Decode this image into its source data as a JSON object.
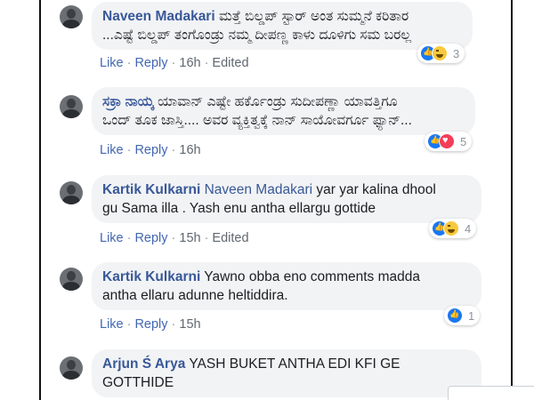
{
  "comments": [
    {
      "author": "Naveen Madakari",
      "mention": "",
      "text_lines": [
        "ಮತ್ತೆ ಬಿಲ್ಡಪ್ ಸ್ಟಾರ್ ಅಂತ ಸುಮ್ಮನೆ ಕರಿತಾರ",
        "...ಎಷ್ಟೆ ಬಿಲ್ಡಪ್ ತಂಗೊಂಡ್ರು ನಮ್ಮ ದೀಪಣ್ಣ ಕಾಳು ದೂಳಿಗು ಸಮ ಬರಲ್ಲ"
      ],
      "like": "Like",
      "reply": "Reply",
      "time": "16h",
      "edited": "Edited",
      "reactions": [
        "like",
        "haha"
      ],
      "reaction_count": "3"
    },
    {
      "author": "ಸಕ್ರಾ ನಾಯ್ಕ",
      "mention": "",
      "text_lines": [
        "ಯಾವಾನ್ ಎಷ್ಟೇ ಹರ್ಕೊಂಡ್ರು ಸುದೀಪಣ್ಣಾ ಯಾವತ್ತಿಗೂ",
        "ಒಂದ್ ತೂಕ ಜಾಸ್ತಿ.... ಅವರ ವ್ಯಕ್ತಿತ್ವಕ್ಕೆ ನಾನ್ ಸಾಯೋವರ್ಗೂ ಫ್ಯಾನ್..."
      ],
      "like": "Like",
      "reply": "Reply",
      "time": "16h",
      "edited": "",
      "reactions": [
        "like",
        "love"
      ],
      "reaction_count": "5"
    },
    {
      "author": "Kartik Kulkarni",
      "mention": "Naveen Madakari",
      "text_lines": [
        "yar yar kalina dhool",
        "gu Sama illa . Yash enu antha ellargu gottide"
      ],
      "like": "Like",
      "reply": "Reply",
      "time": "15h",
      "edited": "Edited",
      "reactions": [
        "like",
        "haha"
      ],
      "reaction_count": "4"
    },
    {
      "author": "Kartik Kulkarni",
      "mention": "",
      "text_lines": [
        "Yawno obba eno comments madda",
        "antha ellaru adunne heltiddira."
      ],
      "like": "Like",
      "reply": "Reply",
      "time": "15h",
      "edited": "",
      "reactions": [
        "like"
      ],
      "reaction_count": "1"
    },
    {
      "author": "Arjun Ś Arya",
      "mention": "",
      "text_lines": [
        "YASH BUKET ANTHA EDI KFI GE",
        "GOTTHIDE"
      ],
      "like": "",
      "reply": "",
      "time": "",
      "edited": "",
      "reactions": [],
      "reaction_count": ""
    }
  ],
  "colors": {
    "author": "#385898",
    "link": "#4267b2",
    "bubble": "#f2f3f5",
    "like_reaction": "#1877f2",
    "love_reaction": "#f33e58",
    "haha_reaction": "#f7c93b"
  }
}
